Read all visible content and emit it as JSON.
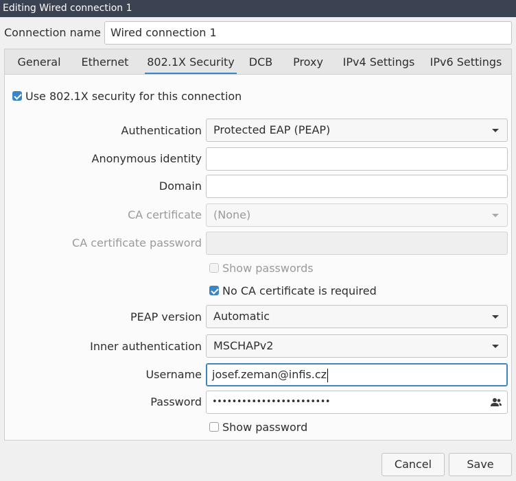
{
  "window": {
    "title": "Editing Wired connection 1"
  },
  "connection": {
    "label": "Connection name",
    "value": "Wired connection 1"
  },
  "tabs": [
    {
      "label": "General"
    },
    {
      "label": "Ethernet"
    },
    {
      "label": "802.1X Security",
      "active": true
    },
    {
      "label": "DCB"
    },
    {
      "label": "Proxy"
    },
    {
      "label": "IPv4 Settings"
    },
    {
      "label": "IPv6 Settings"
    }
  ],
  "security": {
    "use_8021x": {
      "label": "Use 802.1X security for this connection",
      "checked": true
    },
    "authentication": {
      "label": "Authentication",
      "value": "Protected EAP (PEAP)"
    },
    "anonymous_identity": {
      "label": "Anonymous identity",
      "value": ""
    },
    "domain": {
      "label": "Domain",
      "value": ""
    },
    "ca_certificate": {
      "label": "CA certificate",
      "value": "(None)",
      "disabled": true
    },
    "ca_certificate_password": {
      "label": "CA certificate password",
      "value": "",
      "disabled": true
    },
    "show_passwords": {
      "label": "Show passwords",
      "checked": false,
      "disabled": true
    },
    "no_ca_required": {
      "label": "No CA certificate is required",
      "checked": true
    },
    "peap_version": {
      "label": "PEAP version",
      "value": "Automatic"
    },
    "inner_auth": {
      "label": "Inner authentication",
      "value": "MSCHAPv2"
    },
    "username": {
      "label": "Username",
      "value": "josef.zeman@infis.cz"
    },
    "password": {
      "label": "Password",
      "value": "••••••••••••••••••••••••"
    },
    "show_password": {
      "label": "Show password",
      "checked": false
    }
  },
  "buttons": {
    "cancel": "Cancel",
    "save": "Save"
  },
  "colors": {
    "accent": "#3b85c6",
    "titlebar": "#3b4252"
  },
  "icons": {
    "password_storage": "person-icon",
    "combo": "chevron-down-icon"
  }
}
